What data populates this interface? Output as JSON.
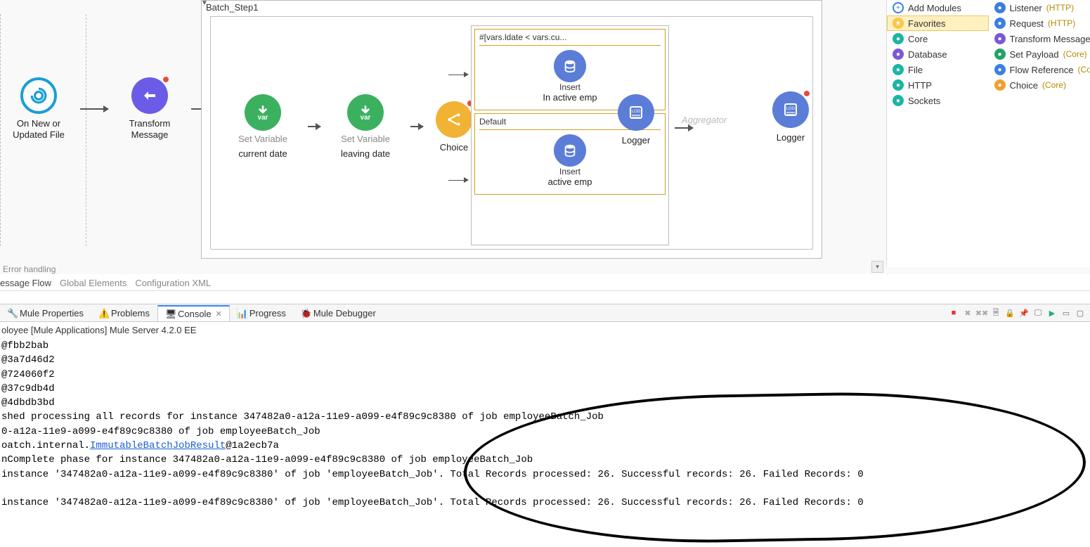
{
  "batch": {
    "title": "Batch_Step1"
  },
  "nodes": {
    "source": {
      "label": "On New or\nUpdated File"
    },
    "transform": {
      "label": "Transform\nMessage"
    },
    "var1": {
      "sub": "Set Variable",
      "label": "current date"
    },
    "var2": {
      "sub": "Set Variable",
      "label": "leaving date"
    },
    "choice": {
      "label": "Choice"
    },
    "logger_in": {
      "label": "Logger"
    },
    "aggregator": {
      "label": "Aggregator"
    },
    "logger_out": {
      "label": "Logger"
    },
    "choice1": {
      "cond": "#[vars.ldate < vars.cu...",
      "sub": "Insert",
      "label": "In active emp"
    },
    "choice2": {
      "cond": "Default",
      "sub": "Insert",
      "label": "active emp"
    }
  },
  "error_label": "Error handling",
  "subtabs": {
    "flow": "essage Flow",
    "globals": "Global Elements",
    "config": "Configuration XML"
  },
  "palette": {
    "left": [
      {
        "icon": "plus",
        "label": "Add Modules"
      },
      {
        "icon": "star",
        "label": "Favorites",
        "selected": true
      },
      {
        "icon": "teal",
        "label": "Core"
      },
      {
        "icon": "purple",
        "label": "Database"
      },
      {
        "icon": "teal",
        "label": "File"
      },
      {
        "icon": "teal",
        "label": "HTTP"
      },
      {
        "icon": "teal",
        "label": "Sockets"
      }
    ],
    "right": [
      {
        "icon": "blue",
        "label": "Listener",
        "suffix": "(HTTP)"
      },
      {
        "icon": "blue",
        "label": "Request",
        "suffix": "(HTTP)"
      },
      {
        "icon": "purple",
        "label": "Transform Message"
      },
      {
        "icon": "green",
        "label": "Set Payload",
        "suffix": "(Core)"
      },
      {
        "icon": "blue",
        "label": "Flow Reference",
        "suffix": "(Cor"
      },
      {
        "icon": "orange",
        "label": "Choice",
        "suffix": "(Core)"
      }
    ]
  },
  "bottomTabs": {
    "muleProps": "Mule Properties",
    "problems": "Problems",
    "console": "Console",
    "progress": "Progress",
    "debugger": "Mule Debugger"
  },
  "consoleHeader": "oloyee [Mule Applications] Mule Server 4.2.0 EE",
  "consoleLines": [
    "@fbb2bab",
    "@3a7d46d2",
    "@724060f2",
    "@37c9db4d",
    "@4dbdb3bd",
    "shed processing all records for instance 347482a0-a12a-11e9-a099-e4f89c9c8380 of job employeeBatch_Job",
    "0-a12a-11e9-a099-e4f89c9c8380 of job employeeBatch_Job",
    "oatch.internal.<a>ImmutableBatchJobResult</a>@1a2ecb7a",
    "nComplete phase for instance 347482a0-a12a-11e9-a099-e4f89c9c8380 of job employeeBatch_Job",
    "instance '347482a0-a12a-11e9-a099-e4f89c9c8380' of job 'employeeBatch_Job'. Total Records processed: 26. Successful records: 26. Failed Records: 0",
    "",
    "instance '347482a0-a12a-11e9-a099-e4f89c9c8380' of job 'employeeBatch_Job'. Total Records processed: 26. Successful records: 26. Failed Records: 0"
  ]
}
